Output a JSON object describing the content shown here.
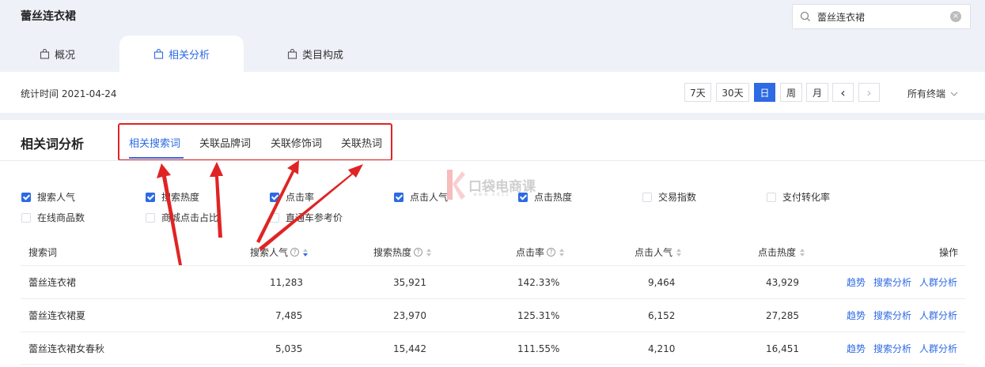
{
  "header": {
    "title": "蕾丝连衣裙",
    "search": {
      "value": "蕾丝连衣裙",
      "clear_icon": "×"
    },
    "tabs": [
      {
        "label": "概况"
      },
      {
        "label": "相关分析"
      },
      {
        "label": "类目构成"
      }
    ]
  },
  "stats": {
    "time_label": "统计时间 2021-04-24",
    "periods": [
      "7天",
      "30天",
      "日",
      "周",
      "月"
    ],
    "active_period": "日",
    "prev_icon": "‹",
    "next_icon": "›",
    "terminal": "所有终端"
  },
  "section": {
    "title": "相关词分析",
    "subtabs": [
      "相关搜索词",
      "关联品牌词",
      "关联修饰词",
      "关联热词"
    ],
    "active_subtab": "相关搜索词"
  },
  "metrics": [
    {
      "label": "搜索人气",
      "checked": true
    },
    {
      "label": "搜索热度",
      "checked": true
    },
    {
      "label": "点击率",
      "checked": true
    },
    {
      "label": "点击人气",
      "checked": true
    },
    {
      "label": "点击热度",
      "checked": true
    },
    {
      "label": "交易指数",
      "checked": false
    },
    {
      "label": "支付转化率",
      "checked": false
    },
    {
      "label": "在线商品数",
      "checked": false
    },
    {
      "label": "商城点击占比",
      "checked": false
    },
    {
      "label": "直通车参考价",
      "checked": false
    }
  ],
  "table": {
    "columns": [
      "搜索词",
      "搜索人气",
      "搜索热度",
      "点击率",
      "点击人气",
      "点击热度",
      "操作"
    ],
    "rows": [
      {
        "keyword": "蕾丝连衣裙",
        "search_pop": "11,283",
        "search_heat": "35,921",
        "ctr": "142.33%",
        "click_pop": "9,464",
        "click_heat": "43,929"
      },
      {
        "keyword": "蕾丝连衣裙夏",
        "search_pop": "7,485",
        "search_heat": "23,970",
        "ctr": "125.31%",
        "click_pop": "6,152",
        "click_heat": "27,285"
      },
      {
        "keyword": "蕾丝连衣裙女春秋",
        "search_pop": "5,035",
        "search_heat": "15,442",
        "ctr": "111.55%",
        "click_pop": "4,210",
        "click_heat": "16,451"
      }
    ],
    "actions": [
      "趋势",
      "搜索分析",
      "人群分析"
    ]
  },
  "watermark": {
    "text": "口袋电商课",
    "url": "www.kd12"
  },
  "colors": {
    "accent": "#2d6ae3",
    "annotation": "#e02424",
    "header_bg": "#eef1f8"
  }
}
